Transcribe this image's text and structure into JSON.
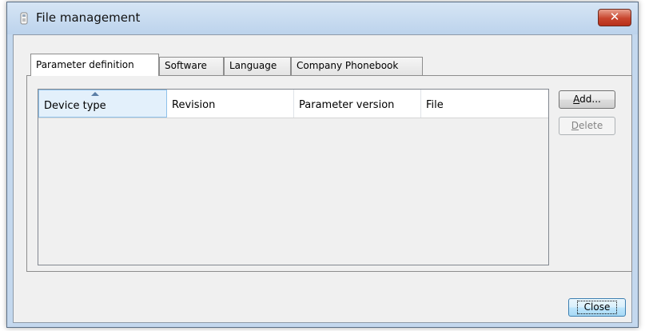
{
  "window": {
    "title": "File management",
    "close_glyph": "✕"
  },
  "tabs": [
    {
      "label": "Parameter definition",
      "active": true
    },
    {
      "label": "Software",
      "active": false
    },
    {
      "label": "Language",
      "active": false
    },
    {
      "label": "Company Phonebook",
      "active": false
    }
  ],
  "table": {
    "columns": [
      "Device type",
      "Revision",
      "Parameter version",
      "File"
    ],
    "sorted_column": "Device type",
    "sort_direction": "ascending",
    "rows": []
  },
  "buttons": {
    "add": {
      "mnemonic": "A",
      "rest": "dd...",
      "enabled": true
    },
    "delete": {
      "mnemonic": "D",
      "rest": "elete",
      "enabled": false
    },
    "close": {
      "label": "Close"
    }
  },
  "icons": {
    "title": "app-icon",
    "close": "close-icon",
    "sort": "sort-ascending-icon"
  },
  "colors": {
    "close_button": "#c8452e",
    "sorted_header": "#e3f0fb"
  }
}
